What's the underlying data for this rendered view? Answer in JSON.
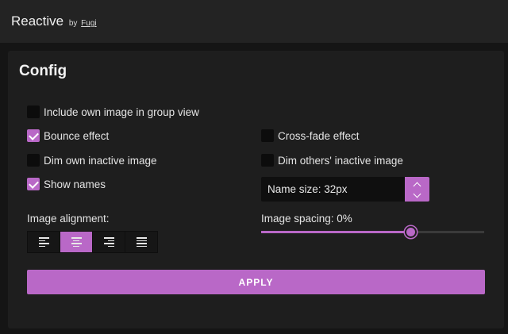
{
  "app": {
    "title": "Reactive",
    "by": "by",
    "author": "Fugi"
  },
  "config": {
    "title": "Config",
    "options": {
      "include_own_image": {
        "label": "Include own image in group view",
        "checked": false
      },
      "bounce_effect": {
        "label": "Bounce effect",
        "checked": true
      },
      "crossfade_effect": {
        "label": "Cross-fade effect",
        "checked": false
      },
      "dim_own_inactive": {
        "label": "Dim own inactive image",
        "checked": false
      },
      "dim_others_inactive": {
        "label": "Dim others' inactive image",
        "checked": false
      },
      "show_names": {
        "label": "Show names",
        "checked": true
      }
    },
    "name_size": {
      "label": "Name size: 32px"
    },
    "image_alignment": {
      "label": "Image alignment:",
      "options": [
        "left",
        "center",
        "right",
        "justify"
      ],
      "selected": "center"
    },
    "image_spacing": {
      "label": "Image spacing: 0%",
      "level": 0.67
    },
    "apply_label": "APPLY"
  },
  "colors": {
    "accent": "#b968c7",
    "background": "#151515",
    "panel": "#1e1e1e",
    "topbar": "#232323"
  },
  "icons": {
    "align_left": "align-left-icon",
    "align_center": "align-center-icon",
    "align_right": "align-right-icon",
    "align_justify": "align-justify-icon",
    "stepper_up": "chevron-up-icon",
    "stepper_down": "chevron-down-icon"
  }
}
